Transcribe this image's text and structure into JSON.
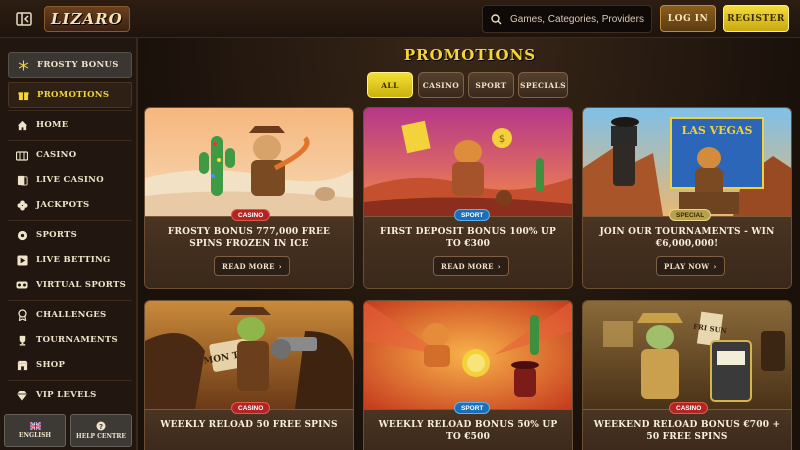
{
  "header": {
    "logo": "LIZARO",
    "search_placeholder": "Games, Categories, Providers",
    "login_label": "LOG IN",
    "register_label": "REGISTER"
  },
  "sidebar": {
    "items": [
      {
        "label": "FROSTY BONUS",
        "icon": "snowflake-icon"
      },
      {
        "label": "PROMOTIONS",
        "icon": "gift-icon"
      },
      {
        "label": "HOME",
        "icon": "home-icon"
      },
      {
        "label": "CASINO",
        "icon": "casino-icon"
      },
      {
        "label": "LIVE CASINO",
        "icon": "cards-icon"
      },
      {
        "label": "JACKPOTS",
        "icon": "clover-icon"
      },
      {
        "label": "SPORTS",
        "icon": "ball-icon"
      },
      {
        "label": "LIVE BETTING",
        "icon": "play-icon"
      },
      {
        "label": "VIRTUAL SPORTS",
        "icon": "vr-icon"
      },
      {
        "label": "CHALLENGES",
        "icon": "medal-icon"
      },
      {
        "label": "TOURNAMENTS",
        "icon": "trophy-icon"
      },
      {
        "label": "SHOP",
        "icon": "shop-icon"
      },
      {
        "label": "VIP LEVELS",
        "icon": "diamond-icon"
      }
    ],
    "language_label": "ENGLISH",
    "help_label": "HELP CENTRE"
  },
  "main": {
    "title": "PROMOTIONS",
    "filters": [
      {
        "label": "ALL",
        "active": true
      },
      {
        "label": "CASINO",
        "active": false
      },
      {
        "label": "SPORT",
        "active": false
      },
      {
        "label": "SPECIALS",
        "active": false
      }
    ],
    "cards": [
      {
        "tag": "CASINO",
        "title": "FROSTY BONUS 777,000 FREE SPINS FROZEN IN ICE",
        "button": "READ MORE"
      },
      {
        "tag": "SPORT",
        "title": "FIRST DEPOSIT BONUS 100% UP TO €300",
        "button": "READ MORE"
      },
      {
        "tag": "SPECIAL",
        "title": "JOIN OUR TOURNAMENTS - WIN €6,000,000!",
        "button": "PLAY NOW"
      },
      {
        "tag": "CASINO",
        "title": "WEEKLY RELOAD 50 FREE SPINS",
        "button": ""
      },
      {
        "tag": "SPORT",
        "title": "WEEKLY RELOAD BONUS 50% UP TO €500",
        "button": ""
      },
      {
        "tag": "CASINO",
        "title": "WEEKEND RELOAD BONUS €700 + 50 FREE SPINS",
        "button": ""
      }
    ],
    "art_text": {
      "card3_sign": "LAS VEGAS",
      "card4_sign": "MON THU",
      "card6_sign": "FRI SUN"
    }
  },
  "colors": {
    "accent_yellow": "#f3d43a",
    "background": "#1a120c",
    "casino_tag": "#b32424",
    "sport_tag": "#1b6fb8",
    "special_tag": "#b8a14e"
  }
}
